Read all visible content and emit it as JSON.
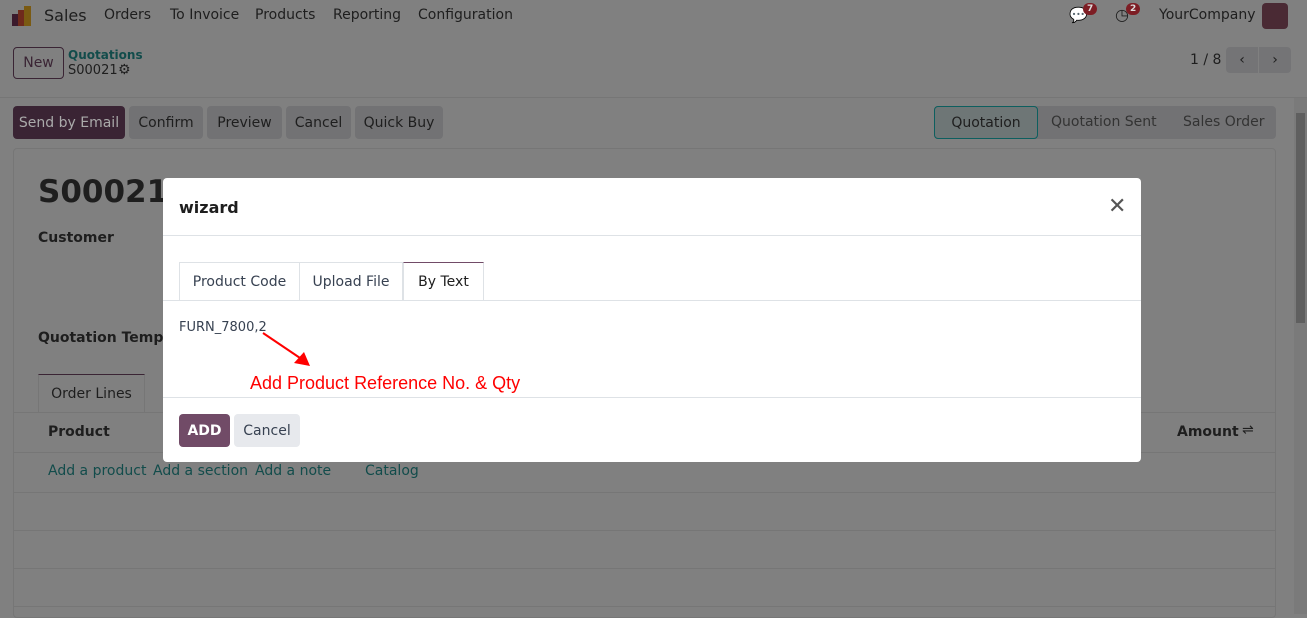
{
  "nav": {
    "app": "Sales",
    "menu": [
      "Orders",
      "To Invoice",
      "Products",
      "Reporting",
      "Configuration"
    ],
    "messages_count": "7",
    "activities_count": "2",
    "company": "YourCompany"
  },
  "control": {
    "new_label": "New",
    "breadcrumb_parent": "Quotations",
    "record": "S00021",
    "pager": "1 / 8"
  },
  "actions": [
    "Send by Email",
    "Confirm",
    "Preview",
    "Cancel",
    "Quick Buy"
  ],
  "status": [
    "Quotation",
    "Quotation Sent",
    "Sales Order"
  ],
  "form": {
    "title": "S00021",
    "customer_label": "Customer",
    "template_label": "Quotation Template",
    "tab": "Order Lines",
    "col_product": "Product",
    "col_amount": "Amount",
    "links": [
      "Add a product",
      "Add a section",
      "Add a note",
      "Catalog"
    ]
  },
  "modal": {
    "title": "wizard",
    "tabs": [
      "Product Code",
      "Upload File",
      "By Text"
    ],
    "active_tab": "By Text",
    "text_value": "FURN_7800,2",
    "annotation": "Add Product Reference No. & Qty",
    "add_label": "ADD",
    "cancel_label": "Cancel"
  },
  "colors": {
    "primary": "#714b67",
    "annotation": "#ff0000"
  }
}
